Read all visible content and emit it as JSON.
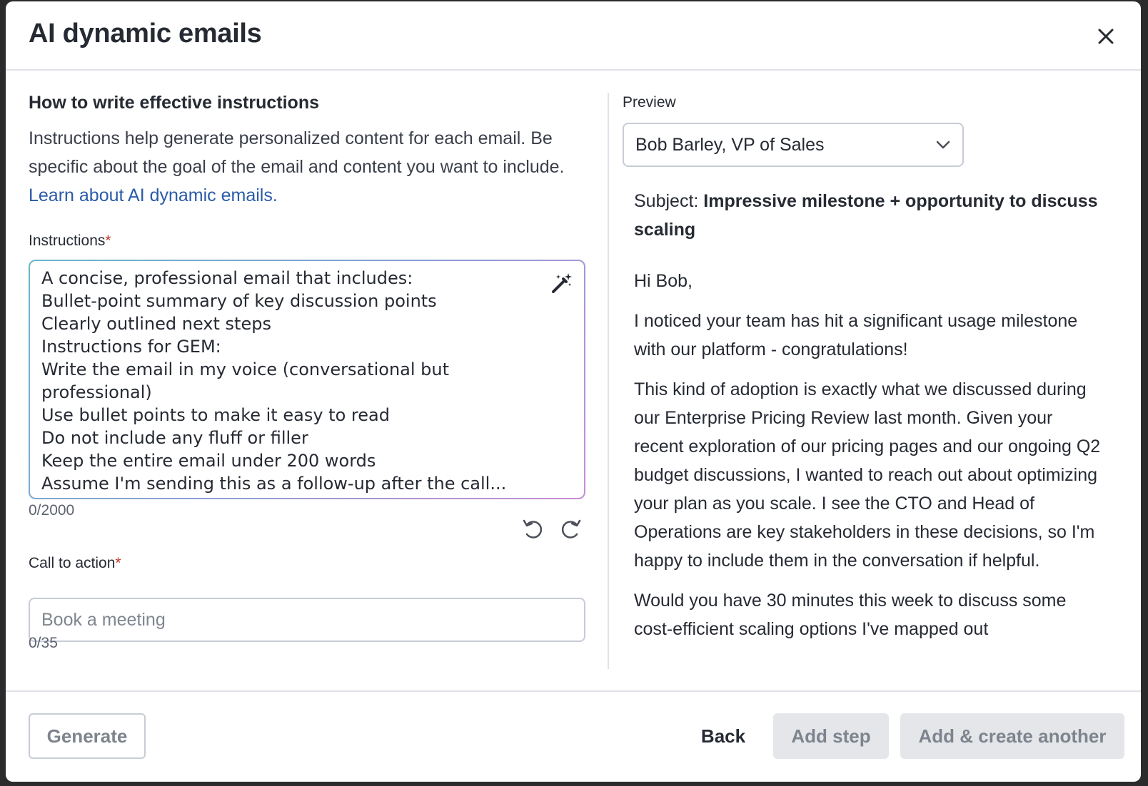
{
  "modal": {
    "title": "AI dynamic emails"
  },
  "guidance": {
    "heading": "How to write effective instructions",
    "body": "Instructions help generate personalized content for each email. Be specific about the goal of the email and content you want to include. ",
    "link_text": "Learn about AI dynamic emails."
  },
  "instructions": {
    "label": "Instructions",
    "required_mark": "*",
    "text": "A concise, professional email that includes:\nBullet-point summary of key discussion points\nClearly outlined next steps\nInstructions for GEM:\nWrite the email in my voice (conversational but professional)\nUse bullet points to make it easy to read\nDo not include any fluff or filler\nKeep the entire email under 200 words\nAssume I'm sending this as a follow-up after the call...",
    "char_count": "0/2000"
  },
  "call_to_action": {
    "label": "Call to action",
    "required_mark": "*",
    "value": "",
    "placeholder": "Book a meeting",
    "char_count": "0/35"
  },
  "preview": {
    "label": "Preview",
    "selected_recipient": "Bob Barley, VP of Sales",
    "subject_prefix": "Subject: ",
    "subject": "Impressive milestone + opportunity to discuss scaling",
    "greeting": "Hi Bob,",
    "paragraphs": [
      "I noticed your team has hit a significant usage milestone with our platform - congratulations!",
      "This kind of adoption is exactly what we discussed during our Enterprise Pricing Review last month. Given your recent exploration of our pricing pages and our ongoing Q2 budget discussions, I wanted to reach out about optimizing your plan as you scale. I see the CTO and Head of Operations are key stakeholders in these decisions, so I'm happy to include them in the conversation if helpful.",
      "Would you have 30 minutes this week to discuss some cost-efficient scaling options I've mapped out"
    ]
  },
  "footer": {
    "generate_label": "Generate",
    "back_label": "Back",
    "add_step_label": "Add step",
    "add_create_label": "Add & create another"
  },
  "icons": {
    "close": "close-icon",
    "magic": "magic-wand-icon",
    "undo": "undo-icon",
    "redo": "redo-icon",
    "dropdown": "chevron-down-icon"
  },
  "colors": {
    "link": "#2a5ba8",
    "required": "#c0392b",
    "disabled_bg": "#e4e6ea",
    "disabled_text": "#7e848d"
  }
}
